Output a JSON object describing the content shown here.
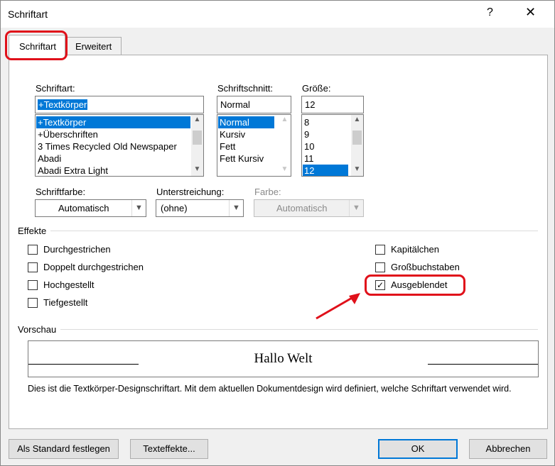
{
  "window": {
    "title": "Schriftart",
    "help": "?",
    "close": "✕"
  },
  "tabs": [
    {
      "label": "Schriftart"
    },
    {
      "label": "Erweitert"
    }
  ],
  "font": {
    "label": "Schriftart:",
    "value": "+Textkörper",
    "items": [
      "+Textkörper",
      "+Überschriften",
      "3 Times Recycled Old Newspaper",
      "Abadi",
      "Abadi Extra Light"
    ]
  },
  "style": {
    "label": "Schriftschnitt:",
    "value": "Normal",
    "items": [
      "Normal",
      "Kursiv",
      "Fett",
      "Fett Kursiv"
    ]
  },
  "size": {
    "label": "Größe:",
    "value": "12",
    "items": [
      "8",
      "9",
      "10",
      "11",
      "12"
    ]
  },
  "color": {
    "label": "Schriftfarbe:",
    "value": "Automatisch"
  },
  "underline": {
    "label": "Unterstreichung:",
    "value": "(ohne)"
  },
  "underline_color": {
    "label": "Farbe:",
    "value": "Automatisch"
  },
  "effects": {
    "label": "Effekte",
    "left": [
      {
        "label": "Durchgestrichen",
        "checked": false
      },
      {
        "label": "Doppelt durchgestrichen",
        "checked": false
      },
      {
        "label": "Hochgestellt",
        "checked": false
      },
      {
        "label": "Tiefgestellt",
        "checked": false
      }
    ],
    "right": [
      {
        "label": "Kapitälchen",
        "checked": false
      },
      {
        "label": "Großbuchstaben",
        "checked": false
      },
      {
        "label": "Ausgeblendet",
        "checked": true
      }
    ]
  },
  "preview": {
    "label": "Vorschau",
    "sample": "Hallo Welt",
    "description": "Dies ist die Textkörper-Designschriftart. Mit dem aktuellen Dokumentdesign wird definiert, welche Schriftart verwendet wird."
  },
  "buttons": {
    "default": "Als Standard festlegen",
    "text_effects": "Texteffekte...",
    "ok": "OK",
    "cancel": "Abbrechen"
  },
  "check_glyph": "✓",
  "annotation_color": "#e0101a"
}
